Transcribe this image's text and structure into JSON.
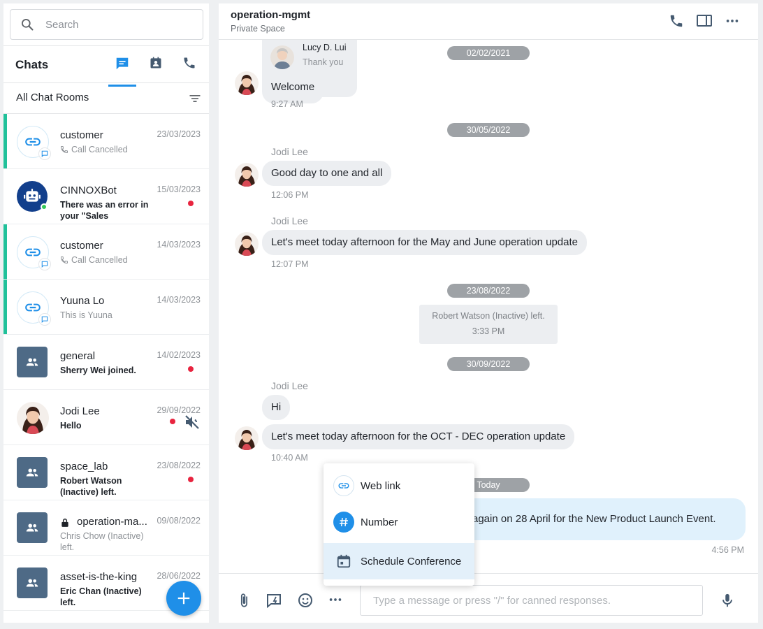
{
  "search": {
    "placeholder": "Search"
  },
  "sidebar": {
    "title": "Chats",
    "filter_label": "All Chat Rooms",
    "items": [
      {
        "name": "customer",
        "sub": "Call Cancelled",
        "date": "23/03/2023"
      },
      {
        "name": "CINNOXBot",
        "sub": "There was an error in your \"Sales Support\"...",
        "date": "15/03/2023"
      },
      {
        "name": "customer",
        "sub": "Call Cancelled",
        "date": "14/03/2023"
      },
      {
        "name": "Yuuna Lo",
        "sub": "This is Yuuna",
        "date": "14/03/2023"
      },
      {
        "name": "general",
        "sub": "Sherry Wei joined.",
        "date": "14/02/2023"
      },
      {
        "name": "Jodi Lee",
        "sub": "Hello",
        "date": "29/09/2022"
      },
      {
        "name": "space_lab",
        "sub": "Robert Watson (Inactive) left.",
        "date": "23/08/2022"
      },
      {
        "name": "operation-ma...",
        "sub": "Chris Chow (Inactive) left.",
        "date": "09/08/2022"
      },
      {
        "name": "asset-is-the-king",
        "sub": "Eric Chan (Inactive) left.",
        "date": "28/06/2022"
      }
    ]
  },
  "header": {
    "title": "operation-mgmt",
    "subtitle": "Private Space"
  },
  "messages": {
    "quote_name": "Lucy D. Lui",
    "quote_text": "Thank you",
    "dates": [
      "02/02/2021",
      "30/05/2022",
      "23/08/2022",
      "30/09/2022",
      "Today"
    ],
    "welcome": "Welcome",
    "t1": "9:27 AM",
    "sender": "Jodi Lee",
    "m2": "Good day to one and all",
    "t2": "12:06 PM",
    "m3": "Let's meet today afternoon for the May and June operation update",
    "t3": "12:07 PM",
    "sys_text": "Robert Watson (Inactive) left.",
    "sys_time": "3:33 PM",
    "m4": "Hi",
    "m5": "Let's meet today afternoon for the OCT - DEC operation update",
    "t5": "10:40 AM",
    "my_msg": "again on 28 April for the New Product Launch Event.",
    "my_time": "4:56 PM"
  },
  "popup": {
    "web_link": "Web link",
    "number": "Number",
    "schedule": "Schedule Conference"
  },
  "composer": {
    "placeholder": "Type a message or press \"/\" for canned responses."
  },
  "colors": {
    "accent": "#1f8fe8",
    "teal": "#20c19a",
    "unread": "#e8243f"
  }
}
